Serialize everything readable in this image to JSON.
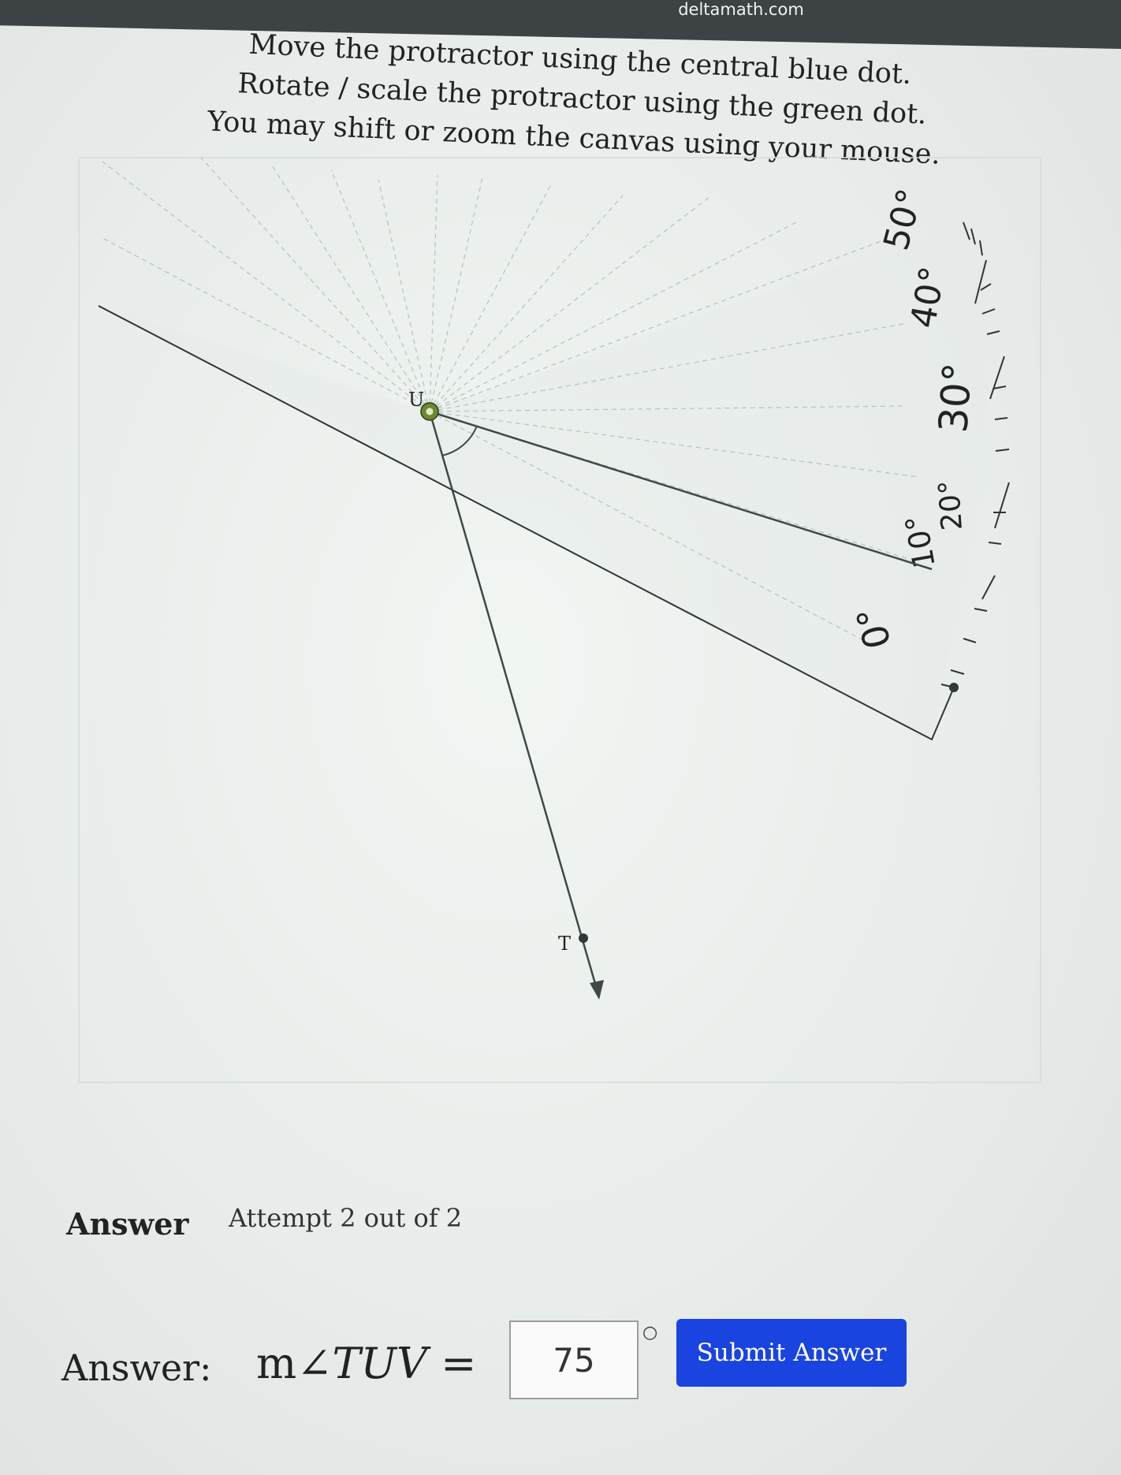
{
  "browser": {
    "url": "deltamath.com"
  },
  "instructions": [
    "Move the protractor using the central blue dot.",
    "Rotate / scale the protractor using the green dot.",
    "You may shift or zoom the canvas using your mouse."
  ],
  "canvas": {
    "point_labels": {
      "vertex": "U",
      "ray_point": "T"
    },
    "protractor_labels": [
      "50°",
      "40°",
      "30°",
      "20°",
      "10°",
      "0°"
    ]
  },
  "answer_section": {
    "heading": "Answer",
    "attempt_text": "Attempt 2 out of 2",
    "answer_label": "Answer:",
    "prefix": "m",
    "angle_symbol": "∠",
    "angle_name": "TUV",
    "equals": "=",
    "input_value": "75",
    "unit_symbol": "○",
    "submit_label": "Submit Answer"
  },
  "colors": {
    "submit_button": "#1a44e0",
    "protractor_handle": "#6d8a2e",
    "lines": "#3f4a47"
  }
}
